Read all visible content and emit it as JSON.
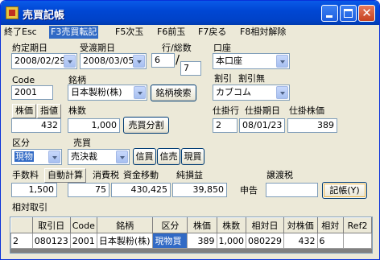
{
  "window": {
    "title": "売買記帳"
  },
  "menu": [
    {
      "label": "終了Esc"
    },
    {
      "label": "F3売買転記"
    },
    {
      "label": "F5次玉"
    },
    {
      "label": "F6前玉"
    },
    {
      "label": "F7戻る"
    },
    {
      "label": "F8相対解除"
    }
  ],
  "form": {
    "contract_date_label": "約定期日",
    "contract_date": "2008/02/29",
    "delivery_date_label": "受渡期日",
    "delivery_date": "2008/03/05",
    "line_total_label": "行/総数",
    "line": "6",
    "total": "7",
    "account_label": "口座",
    "account": "本口座",
    "code_label": "Code",
    "code": "2001",
    "issue_label": "銘柄",
    "issue": "日本製粉(株)",
    "issue_search": "銘柄検索",
    "discount_label": "割引",
    "discount_none_label": "割引無",
    "broker": "カブコム",
    "price_button": "株価",
    "limit_button": "指値",
    "shares_label": "株数",
    "price": "432",
    "shares": "1,000",
    "split_button": "売買分割",
    "pending_row_label": "仕掛行",
    "pending_date_label": "仕掛期日",
    "pending_price_label": "仕掛株価",
    "pending_row": "2",
    "pending_date": "08/01/23",
    "pending_price": "389",
    "category_label": "区分",
    "category": "現物",
    "trade_label": "売買",
    "trade": "売決裁",
    "credit_buy": "信買",
    "credit_sell": "信売",
    "spot_buy": "現買",
    "fee_label": "手数料",
    "auto_calc": "自動計算",
    "tax_label": "消費税",
    "fund_move_label": "資金移動",
    "profit_label": "純損益",
    "transfer_tax_label": "譲渡税",
    "fee": "1,500",
    "tax": "75",
    "fund_move": "430,425",
    "profit": "39,850",
    "declare": "申告",
    "transfer_tax": "",
    "record_button": "記帳(Y)",
    "relative_label": "相対取引"
  },
  "grid": {
    "columns": [
      "",
      "取引日",
      "Code",
      "銘柄",
      "区分",
      "株価",
      "株数",
      "相対日",
      "対株価",
      "相対",
      "Ref2"
    ],
    "rows": [
      [
        "2",
        "080123",
        "2001",
        "日本製粉(株)",
        "現物買",
        "389",
        "1,000",
        "080229",
        "432",
        "6",
        ""
      ]
    ]
  }
}
